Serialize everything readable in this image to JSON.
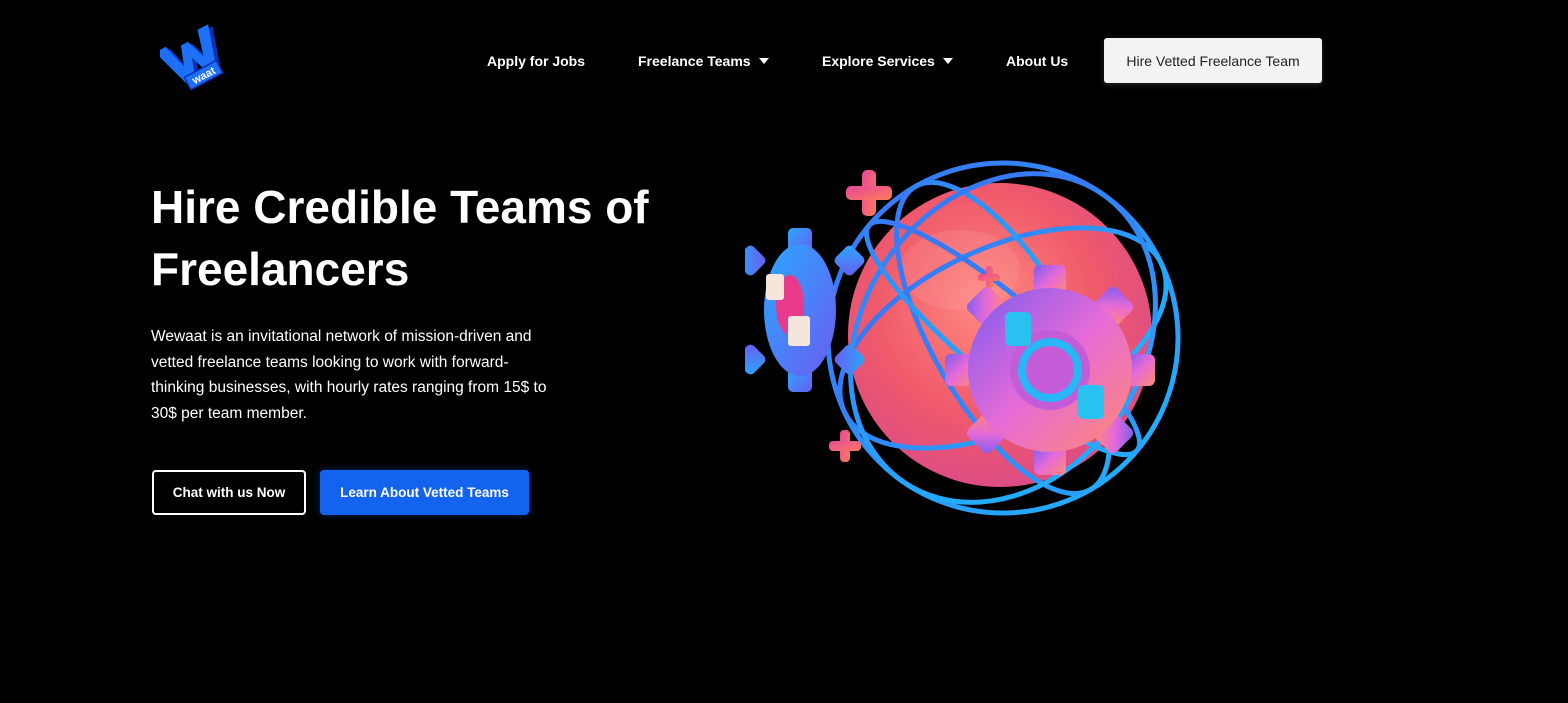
{
  "header": {
    "logo_text": "waat",
    "nav": {
      "apply_jobs": "Apply for Jobs",
      "freelance_teams": "Freelance Teams",
      "explore_services": "Explore Services",
      "about_us": "About Us"
    },
    "cta_label": "Hire Vetted Freelance Team"
  },
  "hero": {
    "title": "Hire Credible Teams of Freelancers",
    "description": "Wewaat is an invitational network of mission-driven and vetted freelance teams looking to work with forward-thinking businesses, with hourly rates ranging from 15$ to 30$ per team member.",
    "primary_button": "Chat with us Now",
    "secondary_button": "Learn About Vetted Teams"
  },
  "colors": {
    "background": "#000000",
    "accent_blue": "#1463ee",
    "cta_background": "#f3f3f3"
  },
  "icons": {
    "logo": "wewaat-logo-icon",
    "dropdown": "caret-down-icon",
    "illustration": "globe-gears-illustration"
  }
}
